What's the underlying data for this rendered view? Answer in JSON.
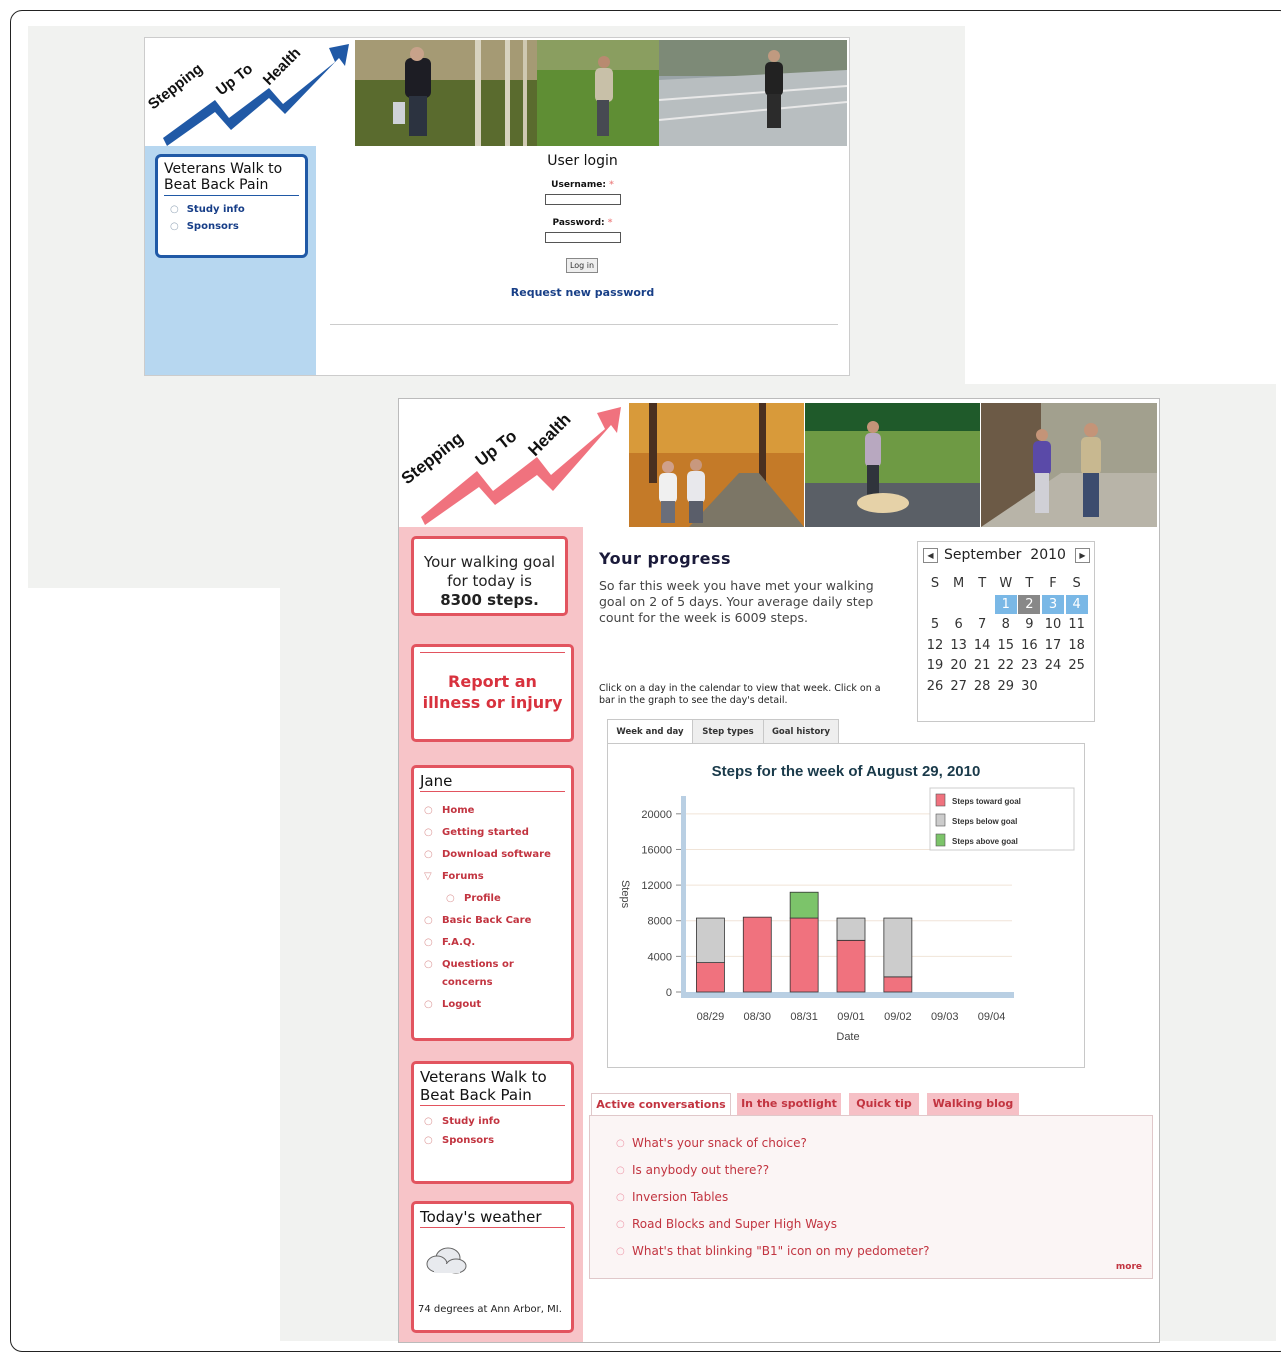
{
  "login_page": {
    "logo": {
      "words": [
        "Stepping",
        "Up To",
        "Health"
      ],
      "color": "#2059a6"
    },
    "sidebar": {
      "title": "Veterans Walk to Beat Back Pain",
      "links": [
        "Study info",
        "Sponsors"
      ]
    },
    "form": {
      "title": "User login",
      "username_label": "Username:",
      "password_label": "Password:",
      "required_mark": "*",
      "username_value": "",
      "password_value": "",
      "login_button": "Log in",
      "request_link": "Request new password"
    }
  },
  "dashboard": {
    "logo": {
      "words": [
        "Stepping",
        "Up To",
        "Health"
      ],
      "color": "#f0727e"
    },
    "goal_box": {
      "line1": "Your walking goal",
      "line2": "for today is",
      "line3": "8300 steps."
    },
    "report_box": {
      "line1": "Report an",
      "line2": "illness or injury"
    },
    "user_menu": {
      "title": "Jane",
      "items": [
        {
          "label": "Home",
          "sub": false
        },
        {
          "label": "Getting started",
          "sub": false
        },
        {
          "label": "Download software",
          "sub": false
        },
        {
          "label": "Forums",
          "sub": false,
          "expanded": true
        },
        {
          "label": "Profile",
          "sub": true
        },
        {
          "label": "Basic Back Care",
          "sub": false
        },
        {
          "label": "F.A.Q.",
          "sub": false
        },
        {
          "label": "Questions or concerns",
          "sub": false
        },
        {
          "label": "Logout",
          "sub": false
        }
      ]
    },
    "veterans_box": {
      "title": "Veterans Walk to Beat Back Pain",
      "links": [
        "Study info",
        "Sponsors"
      ]
    },
    "weather_box": {
      "title": "Today's weather",
      "icon": "cloud-icon",
      "text": "74 degrees at Ann Arbor, MI."
    },
    "progress": {
      "title": "Your progress",
      "text": "So far this week you have met your walking goal on 2 of 5 days. Your average daily step count for the week is 6009 steps.",
      "hint": "Click on a day in the calendar to view that week. Click on a bar in the graph to see the day's detail."
    },
    "calendar": {
      "prev_icon": "prev-arrow-icon",
      "next_icon": "next-arrow-icon",
      "month": "September",
      "year": "2010",
      "weekdays": [
        "S",
        "M",
        "T",
        "W",
        "T",
        "F",
        "S"
      ],
      "first_weekday": 3,
      "days_in_month": 30,
      "highlighted_days": [
        1,
        2,
        3,
        4
      ],
      "selected_day": 2
    },
    "chart_tabs": [
      "Week and day",
      "Step types",
      "Goal history"
    ],
    "chart_active_tab": 0,
    "content_tabs": [
      "Active conversations",
      "In the spotlight",
      "Quick tip",
      "Walking blog"
    ],
    "content_active_tab": 0,
    "conversations": [
      "What's your snack of choice?",
      "Is anybody out there??",
      "Inversion Tables",
      "Road Blocks and Super High Ways",
      "What's that blinking \"B1\" icon on my pedometer?"
    ],
    "more_link": "more"
  },
  "chart_data": {
    "type": "bar",
    "title": "Steps for the week of August 29, 2010",
    "xlabel": "Date",
    "ylabel": "Steps",
    "categories": [
      "08/29",
      "08/30",
      "08/31",
      "09/01",
      "09/02",
      "09/03",
      "09/04"
    ],
    "yticks": [
      0,
      4000,
      8000,
      12000,
      16000,
      20000
    ],
    "ylim": [
      0,
      22000
    ],
    "stacked": true,
    "legend_position": "top-right",
    "series": [
      {
        "name": "Steps toward goal",
        "color": "#f0727e",
        "values": [
          3300,
          8400,
          8300,
          5800,
          1700,
          0,
          0
        ]
      },
      {
        "name": "Steps below goal",
        "color": "#cccccc",
        "values": [
          5000,
          0,
          0,
          2500,
          6600,
          0,
          0
        ]
      },
      {
        "name": "Steps above goal",
        "color": "#7cc46a",
        "values": [
          0,
          0,
          2900,
          0,
          0,
          0,
          0
        ]
      }
    ],
    "grid": true
  }
}
